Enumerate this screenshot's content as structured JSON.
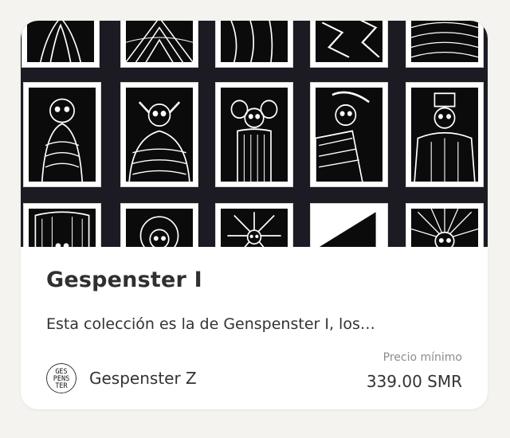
{
  "card": {
    "title": "Gespenster I",
    "description": "Esta colección es la de Genspenster I, los…",
    "creator": {
      "name": "Gespenster Z",
      "avatar_text": [
        "GES",
        "PENS",
        "TER"
      ]
    },
    "price": {
      "label": "Precio mínimo",
      "value": "339.00 SMR"
    },
    "banner": {
      "alt": "gespenster-artwork-grid",
      "tile_count": 15
    }
  },
  "colors": {
    "page_background": "#f4f3ef",
    "card_background": "#ffffff",
    "banner_background": "#1c1b24",
    "title_text": "#2f2f2f",
    "body_text": "#333333",
    "muted_text": "#8c8c8c"
  }
}
